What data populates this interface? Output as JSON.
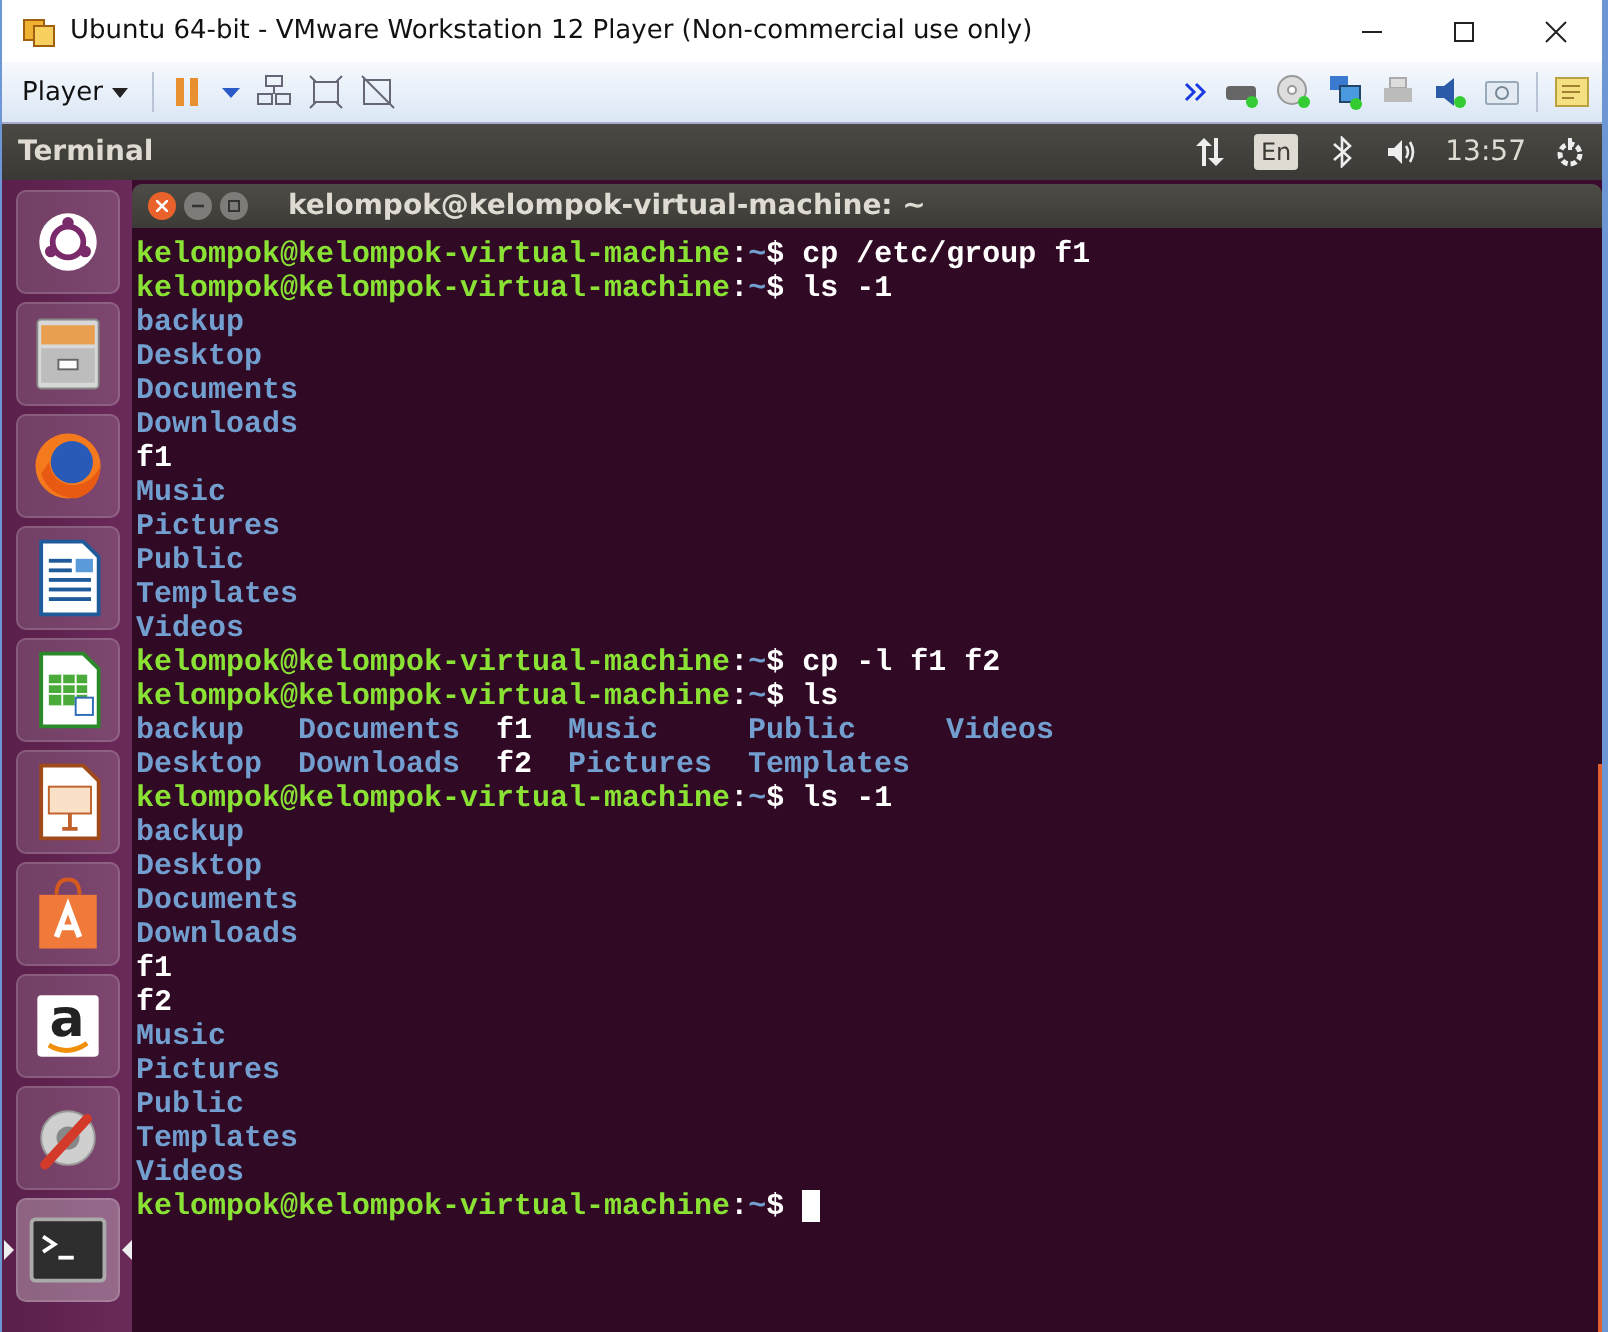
{
  "window": {
    "title": "Ubuntu 64-bit - VMware Workstation 12 Player (Non-commercial use only)"
  },
  "toolbar": {
    "player_menu": "Player"
  },
  "panel": {
    "app_title": "Terminal",
    "keyboard": "En",
    "clock": "13:57"
  },
  "launcher": [
    {
      "kind": "ubuntu",
      "selected": false
    },
    {
      "kind": "files",
      "selected": false
    },
    {
      "kind": "firefox",
      "selected": false
    },
    {
      "kind": "writer",
      "selected": false
    },
    {
      "kind": "calc",
      "selected": false
    },
    {
      "kind": "impress",
      "selected": false
    },
    {
      "kind": "store",
      "selected": false
    },
    {
      "kind": "amazon",
      "selected": false,
      "glyph": "a"
    },
    {
      "kind": "settings",
      "selected": false
    },
    {
      "kind": "terminal",
      "selected": true
    }
  ],
  "terminal": {
    "title": "kelompok@kelompok-virtual-machine: ~",
    "lines": [
      {
        "kind": "prompt",
        "user": "kelompok@kelompok-virtual-machine",
        "sep": ":",
        "path": "~",
        "symbol": "$",
        "command": "cp /etc/group f1"
      },
      {
        "kind": "prompt",
        "user": "kelompok@kelompok-virtual-machine",
        "sep": ":",
        "path": "~",
        "symbol": "$",
        "command": "ls -1"
      },
      {
        "kind": "dir",
        "text": "backup"
      },
      {
        "kind": "dir",
        "text": "Desktop"
      },
      {
        "kind": "dir",
        "text": "Documents"
      },
      {
        "kind": "dir",
        "text": "Downloads"
      },
      {
        "kind": "file",
        "text": "f1"
      },
      {
        "kind": "dir",
        "text": "Music"
      },
      {
        "kind": "dir",
        "text": "Pictures"
      },
      {
        "kind": "dir",
        "text": "Public"
      },
      {
        "kind": "dir",
        "text": "Templates"
      },
      {
        "kind": "dir",
        "text": "Videos"
      },
      {
        "kind": "prompt",
        "user": "kelompok@kelompok-virtual-machine",
        "sep": ":",
        "path": "~",
        "symbol": "$",
        "command": "cp -l f1 f2"
      },
      {
        "kind": "prompt",
        "user": "kelompok@kelompok-virtual-machine",
        "sep": ":",
        "path": "~",
        "symbol": "$",
        "command": "ls"
      },
      {
        "kind": "columns",
        "rows": [
          [
            {
              "kind": "dir",
              "text": "backup"
            },
            {
              "kind": "dir",
              "text": "Documents"
            },
            {
              "kind": "file",
              "text": "f1"
            },
            {
              "kind": "dir",
              "text": "Music"
            },
            {
              "kind": "dir",
              "text": "Public"
            },
            {
              "kind": "dir",
              "text": "Videos"
            }
          ],
          [
            {
              "kind": "dir",
              "text": "Desktop"
            },
            {
              "kind": "dir",
              "text": "Downloads"
            },
            {
              "kind": "file",
              "text": "f2"
            },
            {
              "kind": "dir",
              "text": "Pictures"
            },
            {
              "kind": "dir",
              "text": "Templates"
            }
          ]
        ]
      },
      {
        "kind": "prompt",
        "user": "kelompok@kelompok-virtual-machine",
        "sep": ":",
        "path": "~",
        "symbol": "$",
        "command": "ls -1"
      },
      {
        "kind": "dir",
        "text": "backup"
      },
      {
        "kind": "dir",
        "text": "Desktop"
      },
      {
        "kind": "dir",
        "text": "Documents"
      },
      {
        "kind": "dir",
        "text": "Downloads"
      },
      {
        "kind": "file",
        "text": "f1"
      },
      {
        "kind": "file",
        "text": "f2"
      },
      {
        "kind": "dir",
        "text": "Music"
      },
      {
        "kind": "dir",
        "text": "Pictures"
      },
      {
        "kind": "dir",
        "text": "Public"
      },
      {
        "kind": "dir",
        "text": "Templates"
      },
      {
        "kind": "dir",
        "text": "Videos"
      },
      {
        "kind": "prompt",
        "user": "kelompok@kelompok-virtual-machine",
        "sep": ":",
        "path": "~",
        "symbol": "$",
        "cursor": true
      }
    ]
  }
}
